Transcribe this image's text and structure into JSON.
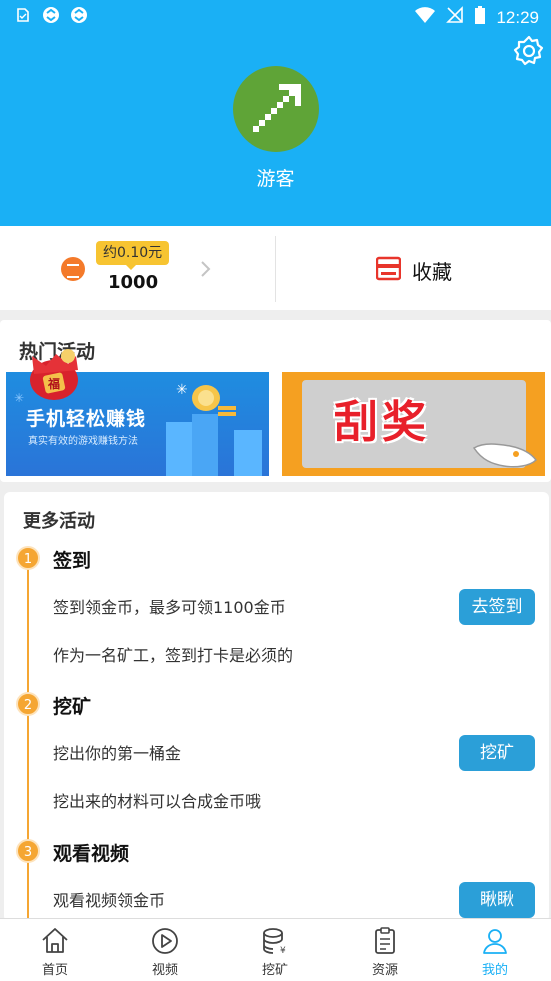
{
  "status_bar": {
    "time": "12:29",
    "left_icons": [
      "notification-icon",
      "sync-icon",
      "sync-icon"
    ],
    "right_icons": [
      "wifi-icon",
      "no-signal-icon",
      "battery-icon"
    ]
  },
  "profile": {
    "nickname": "游客",
    "avatar_icon": "pickaxe-icon",
    "settings_icon": "gear-icon"
  },
  "wallet": {
    "badge": "约0.10元",
    "coins": "1000",
    "favorites_label": "收藏"
  },
  "hot_activities": {
    "title": "热门活动",
    "banner1": {
      "title": "手机轻松赚钱",
      "subtitle": "真实有效的游戏赚钱方法",
      "tag": "福"
    },
    "banner2": {
      "title": "刮奖"
    }
  },
  "more_activities": {
    "title": "更多活动",
    "steps": [
      {
        "num": "1",
        "title": "签到",
        "line1": "签到领金币，最多可领1100金币",
        "line2": "作为一名矿工，签到打卡是必须的",
        "button": "去签到"
      },
      {
        "num": "2",
        "title": "挖矿",
        "line1": "挖出你的第一桶金",
        "line2": "挖出来的材料可以合成金币哦",
        "button": "挖矿"
      },
      {
        "num": "3",
        "title": "观看视频",
        "line1": "观看视频领金币",
        "line2": "",
        "button": "瞅瞅"
      }
    ]
  },
  "bottom_nav": [
    {
      "label": "首页",
      "icon": "home-icon"
    },
    {
      "label": "视频",
      "icon": "play-icon"
    },
    {
      "label": "挖矿",
      "icon": "coins-icon"
    },
    {
      "label": "资源",
      "icon": "clipboard-icon"
    },
    {
      "label": "我的",
      "icon": "user-icon",
      "active": true
    }
  ],
  "colors": {
    "header": "#1ab0f5",
    "accent": "#f5a633",
    "button": "#2b9fd8",
    "coin": "#f47a2a"
  }
}
